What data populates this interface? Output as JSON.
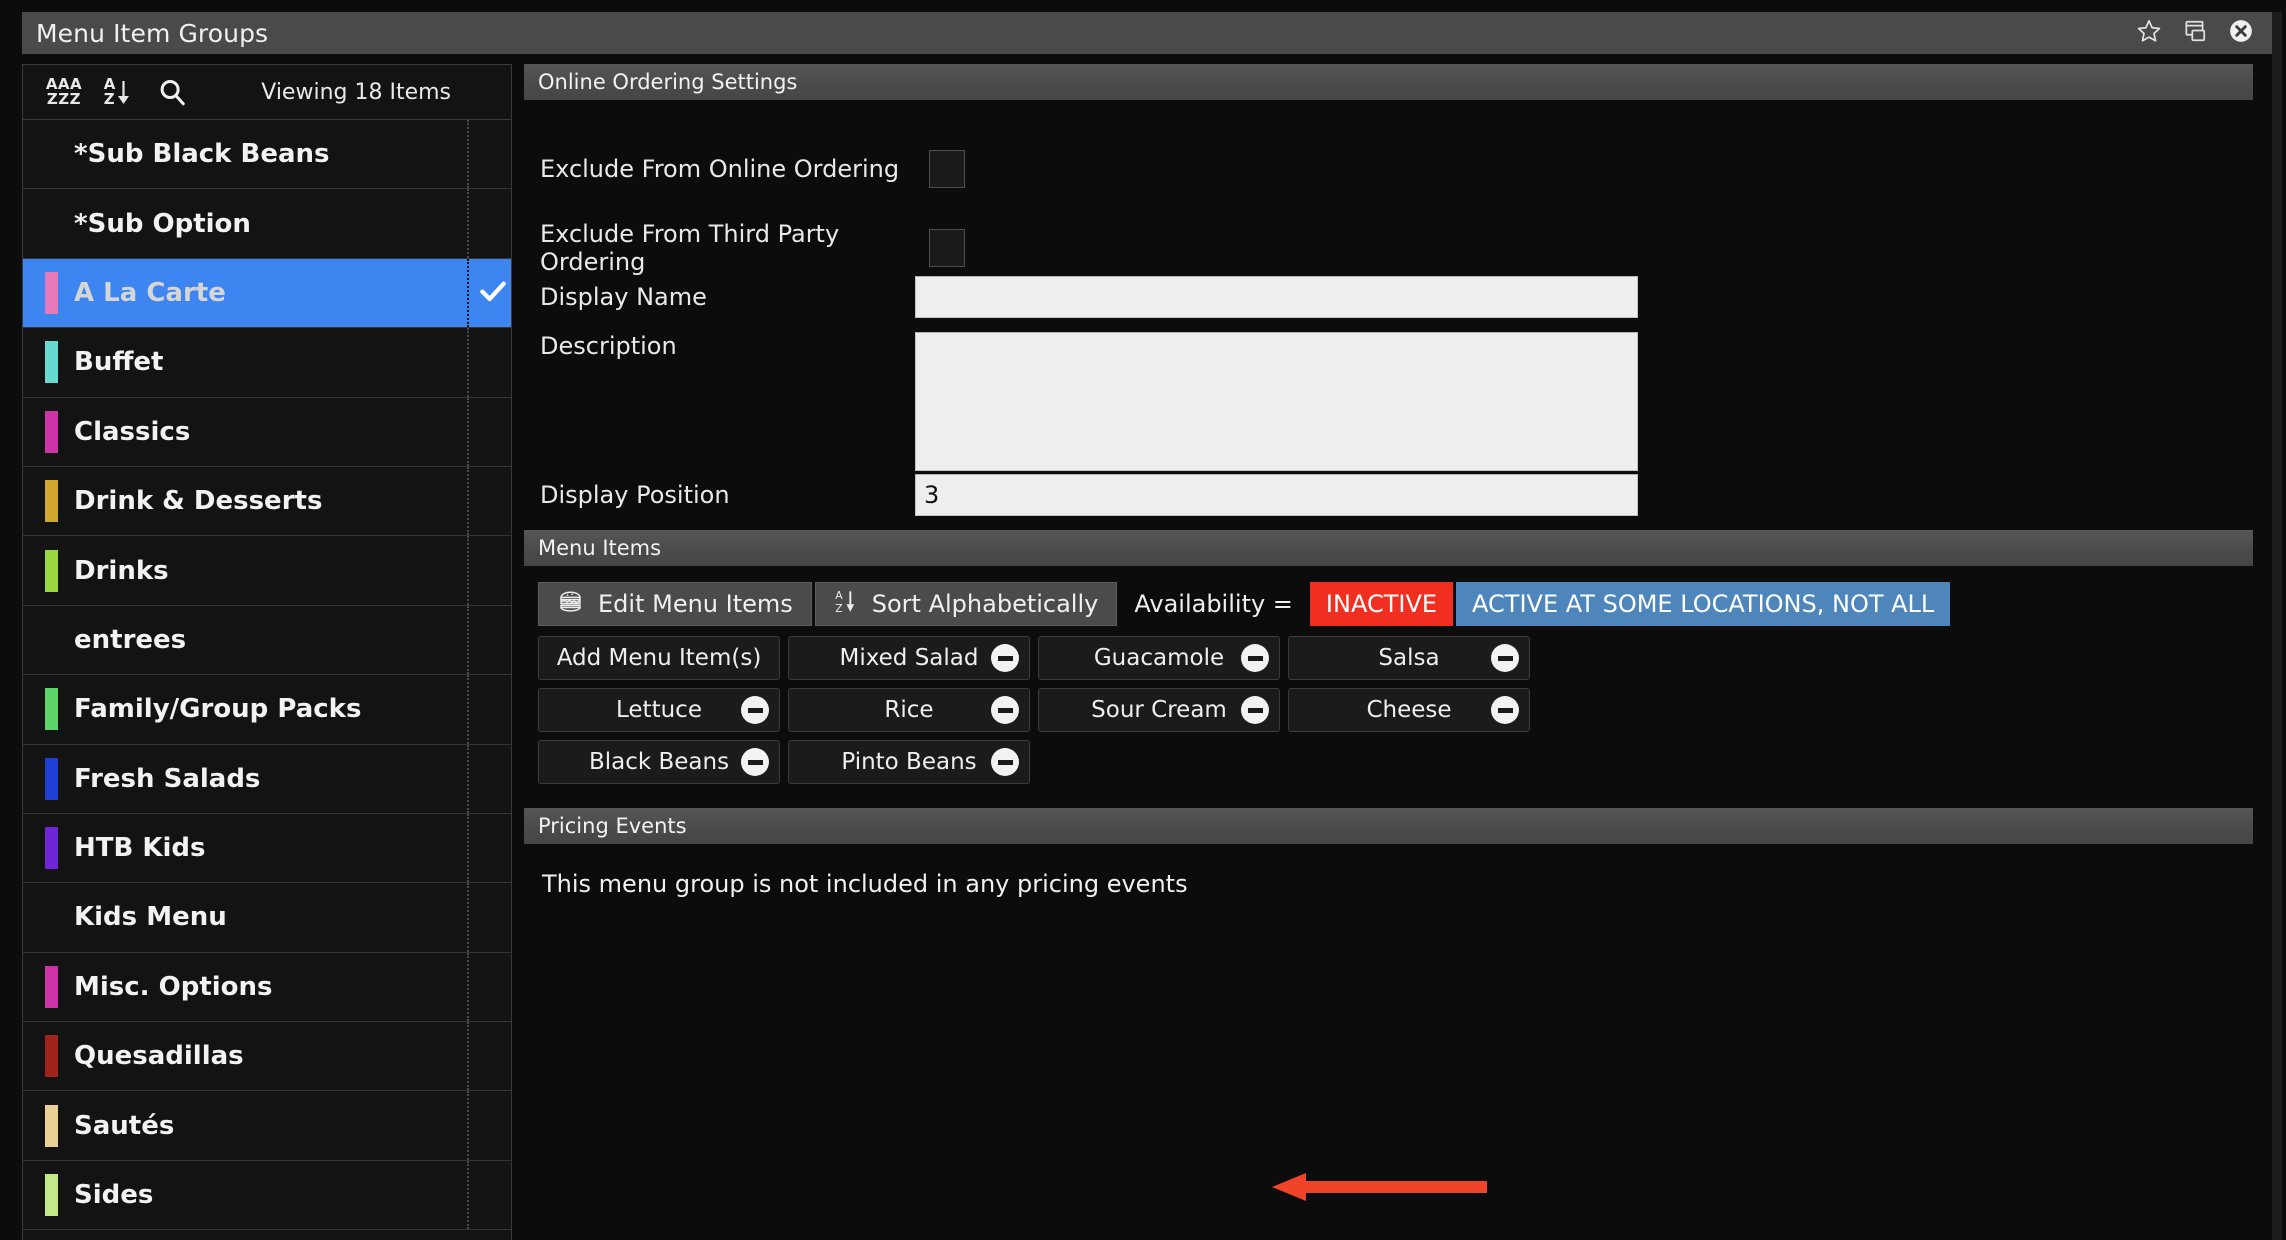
{
  "window": {
    "title": "Menu Item Groups",
    "icons": [
      {
        "name": "favorite-star-icon",
        "glyph": "star"
      },
      {
        "name": "restore-window-icon",
        "glyph": "restore"
      },
      {
        "name": "close-window-icon",
        "glyph": "close"
      }
    ]
  },
  "sidebar": {
    "toolbar": {
      "sort_az_lines": [
        "AAA",
        "ZZZ"
      ],
      "sort_arrow_letters": [
        "A",
        "Z"
      ],
      "search_icon": "search-icon",
      "viewing_text": "Viewing 18 Items"
    },
    "items": [
      {
        "label": "*Sub Black Beans",
        "color": "",
        "selected": false
      },
      {
        "label": "*Sub Option",
        "color": "",
        "selected": false
      },
      {
        "label": "A La Carte",
        "color": "#e879b8",
        "selected": true
      },
      {
        "label": "Buffet",
        "color": "#66d9d0",
        "selected": false
      },
      {
        "label": "Classics",
        "color": "#cf32a6",
        "selected": false
      },
      {
        "label": "Drink & Desserts",
        "color": "#d2a72f",
        "selected": false
      },
      {
        "label": "Drinks",
        "color": "#9ad63d",
        "selected": false
      },
      {
        "label": "entrees",
        "color": "",
        "selected": false
      },
      {
        "label": "Family/Group Packs",
        "color": "#5ed36a",
        "selected": false
      },
      {
        "label": "Fresh Salads",
        "color": "#1f3fd4",
        "selected": false
      },
      {
        "label": "HTB Kids",
        "color": "#6f25d8",
        "selected": false
      },
      {
        "label": "Kids Menu",
        "color": "",
        "selected": false
      },
      {
        "label": "Misc. Options",
        "color": "#cf32a6",
        "selected": false
      },
      {
        "label": "Quesadillas",
        "color": "#9e2318",
        "selected": false
      },
      {
        "label": "Sautés",
        "color": "#ebd096",
        "selected": false
      },
      {
        "label": "Sides",
        "color": "#c3e889",
        "selected": false
      }
    ],
    "selected_check_icon": "check-icon"
  },
  "online_ordering": {
    "section_title": "Online Ordering Settings",
    "fields": [
      {
        "label": "Exclude From Online Ordering",
        "type": "checkbox",
        "checked": false
      },
      {
        "label": "Exclude From Third Party Ordering",
        "type": "checkbox",
        "checked": false
      },
      {
        "label": "Display Name",
        "type": "text",
        "value": "",
        "placeholder": ""
      },
      {
        "label": "Description",
        "type": "textarea",
        "value": "",
        "placeholder": ""
      },
      {
        "label": "Display Position",
        "type": "text",
        "value": "3",
        "placeholder": ""
      }
    ],
    "exclude_online_label": "Exclude From Online Ordering",
    "exclude_third_party_label": "Exclude From Third Party Ordering",
    "display_name_label": "Display Name",
    "display_name_value": "",
    "description_label": "Description",
    "description_value": "",
    "display_position_label": "Display Position",
    "display_position_value": "3"
  },
  "menu_items": {
    "section_title": "Menu Items",
    "edit_button": "Edit Menu Items",
    "edit_button_icon": "burger-icon",
    "sort_button": "Sort Alphabetically",
    "sort_button_icon": "sort-az-icon",
    "availability_label": "Availability =",
    "badge_inactive": "INACTIVE",
    "badge_inactive_color": "#f02f21",
    "badge_some_locations": "ACTIVE AT SOME LOCATIONS, NOT ALL",
    "badge_some_locations_color": "#4e86bb",
    "add_button": "Add Menu Item(s)",
    "items": [
      {
        "label": "Mixed Salad",
        "removable": true
      },
      {
        "label": "Guacamole",
        "removable": true
      },
      {
        "label": "Salsa",
        "removable": true
      },
      {
        "label": "Lettuce",
        "removable": true
      },
      {
        "label": "Rice",
        "removable": true
      },
      {
        "label": "Sour Cream",
        "removable": true
      },
      {
        "label": "Cheese",
        "removable": true
      },
      {
        "label": "Black Beans",
        "removable": true
      },
      {
        "label": "Pinto Beans",
        "removable": true
      }
    ]
  },
  "pricing_events": {
    "section_title": "Pricing Events",
    "empty_message": "This menu group is not included in any pricing events",
    "annotation_arrow_color": "#ef4427"
  }
}
